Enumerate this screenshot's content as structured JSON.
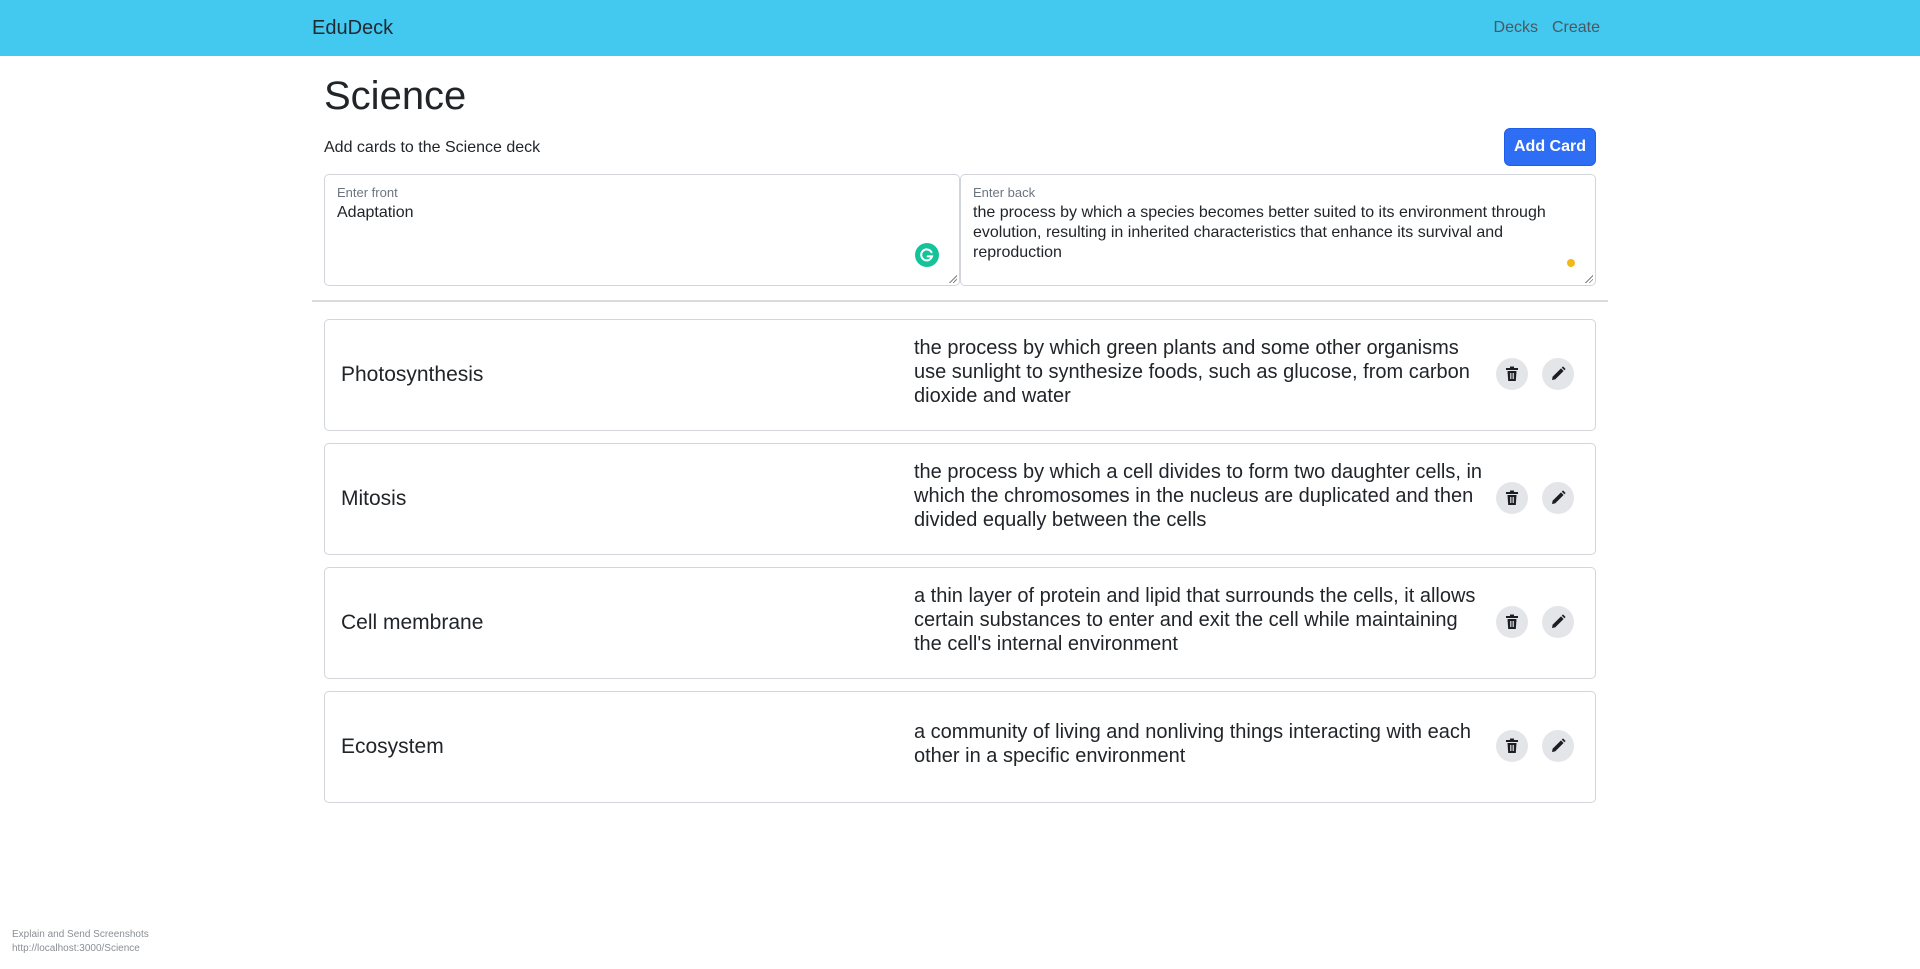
{
  "navbar": {
    "brand": "EduDeck",
    "links": [
      "Decks",
      "Create"
    ]
  },
  "page": {
    "title": "Science",
    "subtitle": "Add cards to the Science deck",
    "add_card_label": "Add Card"
  },
  "form": {
    "front_label": "Enter front",
    "front_value": "Adaptation",
    "back_label": "Enter back",
    "back_value": "the process by which a species becomes better suited to its environment through evolution, resulting in inherited characteristics that enhance its survival and reproduction"
  },
  "cards": [
    {
      "front": "Photosynthesis",
      "back": "the process by which green plants and some other organisms use sunlight to synthesize foods, such as glucose, from carbon dioxide and water"
    },
    {
      "front": "Mitosis",
      "back": "the process by which a cell divides to form two daughter cells, in which the chromosomes in the nucleus are duplicated and then divided equally between the cells"
    },
    {
      "front": "Cell membrane",
      "back": "a thin layer of protein and lipid that surrounds the cells, it allows certain substances to enter and exit the cell while maintaining the cell's internal environment"
    },
    {
      "front": "Ecosystem",
      "back": "a community of living and nonliving things interacting with each other in a specific environment"
    }
  ],
  "footer": {
    "line1": "Explain and Send Screenshots",
    "line2": "http://localhost:3000/Science"
  },
  "icons": {
    "delete": "trash-icon",
    "edit": "pencil-icon",
    "grammarly": "grammarly-icon"
  },
  "colors": {
    "navbar": "#43c8ef",
    "primary_button": "#2e6ef5",
    "grammarly": "#15c39a",
    "status_dot": "#f2b718"
  }
}
